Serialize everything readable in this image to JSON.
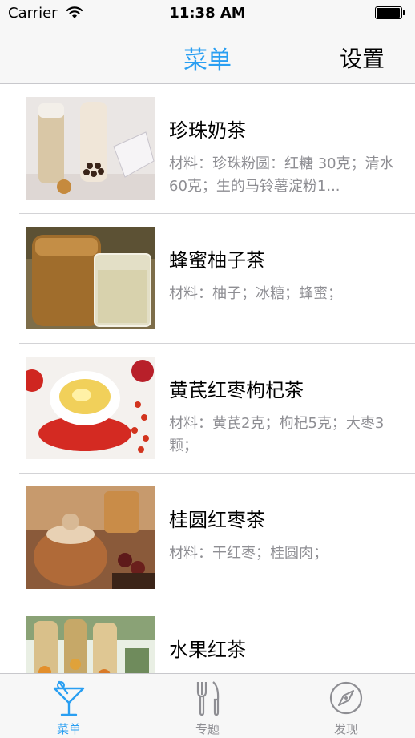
{
  "status_bar": {
    "carrier": "Carrier",
    "time": "11:38 AM"
  },
  "nav": {
    "title": "菜单",
    "right_button": "设置"
  },
  "items": [
    {
      "title": "珍珠奶茶",
      "desc": "材料：珍珠粉圆：红糖 30克；清水60克；生的马铃薯淀粉1...",
      "image": "pearl-milk-tea-photo"
    },
    {
      "title": "蜂蜜柚子茶",
      "desc": "材料：柚子；冰糖；蜂蜜；",
      "image": "honey-citron-tea-photo"
    },
    {
      "title": "黄芪红枣枸杞茶",
      "desc": "材料：黄芪2克；枸杞5克；大枣3颗；",
      "image": "astragalus-jujube-goji-tea-photo"
    },
    {
      "title": "桂圆红枣茶",
      "desc": "材料：干红枣；桂圆肉；",
      "image": "longan-jujube-tea-photo"
    },
    {
      "title": "水果红茶",
      "desc": "",
      "image": "fruit-black-tea-photo"
    }
  ],
  "tabs": [
    {
      "label": "菜单",
      "icon": "cocktail-glass-icon",
      "active": true
    },
    {
      "label": "专题",
      "icon": "fork-knife-icon",
      "active": false
    },
    {
      "label": "发现",
      "icon": "compass-icon",
      "active": false
    }
  ],
  "colors": {
    "accent": "#2a9ff2",
    "inactive": "#8e8e93",
    "bar_background": "#f7f7f7"
  }
}
